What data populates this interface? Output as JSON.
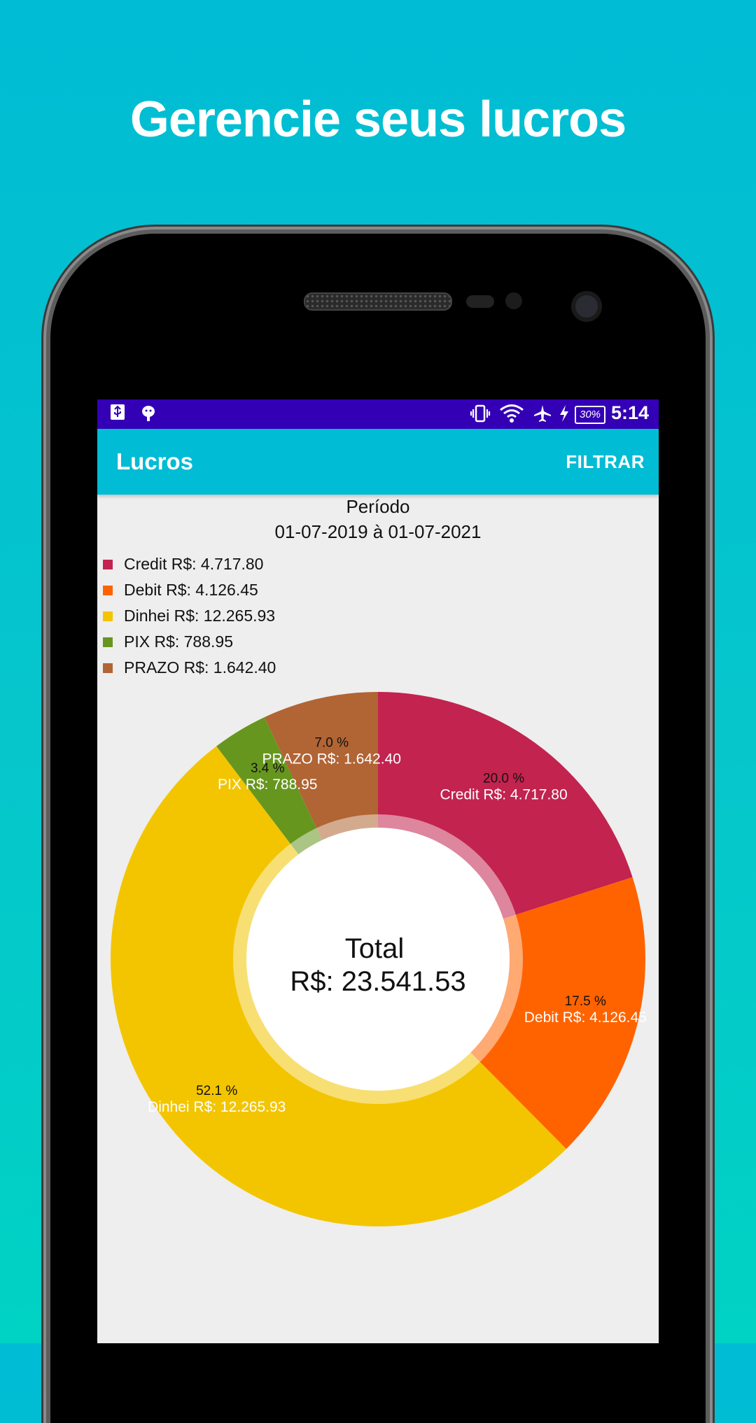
{
  "promo": {
    "headline": "Gerencie seus lucros"
  },
  "status_bar": {
    "time": "5:14",
    "battery": "30%",
    "icons": [
      "usb-icon",
      "android-debug-icon",
      "vibrate-icon",
      "wifi-icon",
      "airplane-icon",
      "charging-icon",
      "battery-icon"
    ],
    "background": "#3400b6"
  },
  "app_bar": {
    "title": "Lucros",
    "filter_label": "FILTRAR",
    "background": "#00bcd4"
  },
  "period": {
    "label": "Período",
    "range": "01-07-2019 à 01-07-2021"
  },
  "legend": [
    {
      "label": "Credit R$: 4.717.80",
      "color": "#c2234f"
    },
    {
      "label": "Debit R$: 4.126.45",
      "color": "#ff6300"
    },
    {
      "label": "Dinhei R$: 12.265.93",
      "color": "#f3c500"
    },
    {
      "label": "PIX R$: 788.95",
      "color": "#67961f"
    },
    {
      "label": "PRAZO R$: 1.642.40",
      "color": "#b16434"
    }
  ],
  "chart_data": {
    "type": "pie",
    "donut": true,
    "center_title": "Total",
    "center_value": "R$: 23.541.53",
    "slices": [
      {
        "name": "Credit",
        "value": 4717.8,
        "percent": 20.0,
        "percent_label": "20.0 %",
        "value_label": "Credit R$: 4.717.80",
        "color": "#c2234f"
      },
      {
        "name": "Debit",
        "value": 4126.45,
        "percent": 17.5,
        "percent_label": "17.5 %",
        "value_label": "Debit R$: 4.126.45",
        "color": "#ff6300"
      },
      {
        "name": "Dinhei",
        "value": 12265.93,
        "percent": 52.1,
        "percent_label": "52.1 %",
        "value_label": "Dinhei R$: 12.265.93",
        "color": "#f3c500"
      },
      {
        "name": "PIX",
        "value": 788.95,
        "percent": 3.4,
        "percent_label": "3.4 %",
        "value_label": "PIX R$: 788.95",
        "color": "#67961f"
      },
      {
        "name": "PRAZO",
        "value": 1642.4,
        "percent": 7.0,
        "percent_label": "7.0 %",
        "value_label": "PRAZO R$: 1.642.40",
        "color": "#b16434"
      }
    ],
    "legend_position": "top-left"
  }
}
